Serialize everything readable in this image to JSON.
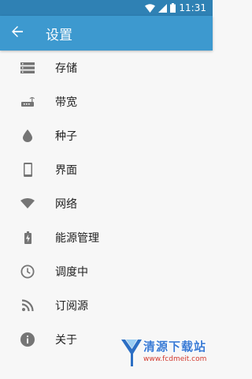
{
  "statusbar": {
    "time": "11:31"
  },
  "toolbar": {
    "title": "设置"
  },
  "menu": [
    {
      "label": "存储",
      "icon": "storage-icon"
    },
    {
      "label": "带宽",
      "icon": "router-icon"
    },
    {
      "label": "种子",
      "icon": "seed-drop-icon"
    },
    {
      "label": "界面",
      "icon": "phone-icon"
    },
    {
      "label": "网络",
      "icon": "wifi-icon"
    },
    {
      "label": "能源管理",
      "icon": "battery-icon"
    },
    {
      "label": "调度中",
      "icon": "clock-icon"
    },
    {
      "label": "订阅源",
      "icon": "rss-icon"
    },
    {
      "label": "关于",
      "icon": "info-icon"
    }
  ],
  "watermark": {
    "name": "清源下载站",
    "url": "www.fcdmeit.com"
  },
  "colors": {
    "toolbar": "#3d99cf",
    "statusbar": "#2f81b4",
    "icon": "#757575"
  }
}
